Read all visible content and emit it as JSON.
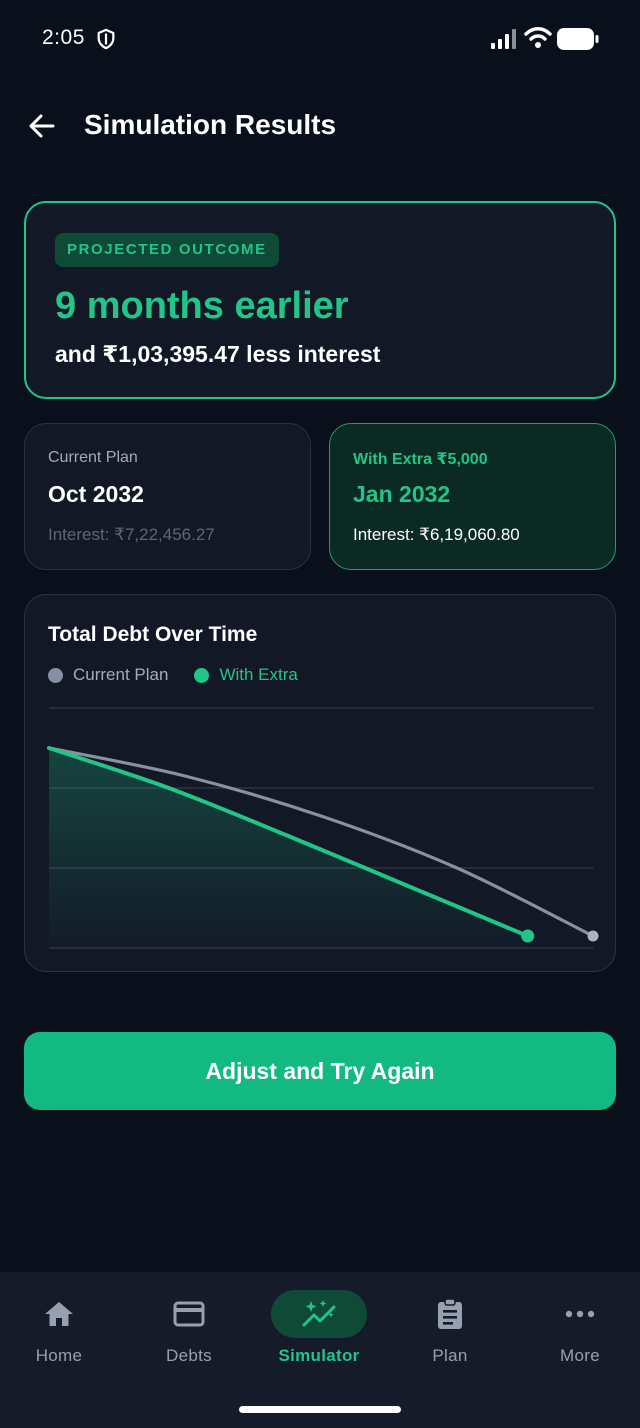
{
  "status_bar": {
    "time": "2:05"
  },
  "header": {
    "title": "Simulation Results"
  },
  "outcome": {
    "badge": "PROJECTED OUTCOME",
    "headline": "9 months earlier",
    "subline": "and ₹1,03,395.47 less interest"
  },
  "comparison": {
    "current": {
      "label": "Current Plan",
      "date": "Oct 2032",
      "interest": "Interest: ₹7,22,456.27"
    },
    "extra": {
      "label": "With Extra ₹5,000",
      "date": "Jan 2032",
      "interest": "Interest: ₹6,19,060.80"
    }
  },
  "chart": {
    "title": "Total Debt Over Time",
    "legend": {
      "current": "Current Plan",
      "extra": "With Extra"
    }
  },
  "chart_data": {
    "type": "line",
    "title": "Total Debt Over Time",
    "grid": true,
    "legend_position": "top-left",
    "series": [
      {
        "name": "Current Plan",
        "color": "#8791a3",
        "x": [
          0,
          0.25,
          0.5,
          0.75,
          1.0
        ],
        "y": [
          100,
          86,
          66,
          40,
          6
        ]
      },
      {
        "name": "With Extra",
        "color": "#22c588",
        "x": [
          0,
          0.22,
          0.44,
          0.66,
          0.88
        ],
        "y": [
          100,
          80,
          56,
          31,
          6
        ]
      }
    ],
    "ylim": [
      0,
      120
    ],
    "xlim": [
      0,
      1
    ]
  },
  "actions": {
    "retry_label": "Adjust and Try Again"
  },
  "nav": {
    "items": [
      {
        "label": "Home",
        "icon": "home-icon"
      },
      {
        "label": "Debts",
        "icon": "card-icon"
      },
      {
        "label": "Simulator",
        "icon": "sparkle-chart-icon"
      },
      {
        "label": "Plan",
        "icon": "clipboard-icon"
      },
      {
        "label": "More",
        "icon": "more-dots-icon"
      }
    ],
    "active": "Simulator"
  },
  "colors": {
    "accent": "#22c588",
    "button": "#12b981",
    "background": "#0a0f1c",
    "card": "#121826"
  }
}
